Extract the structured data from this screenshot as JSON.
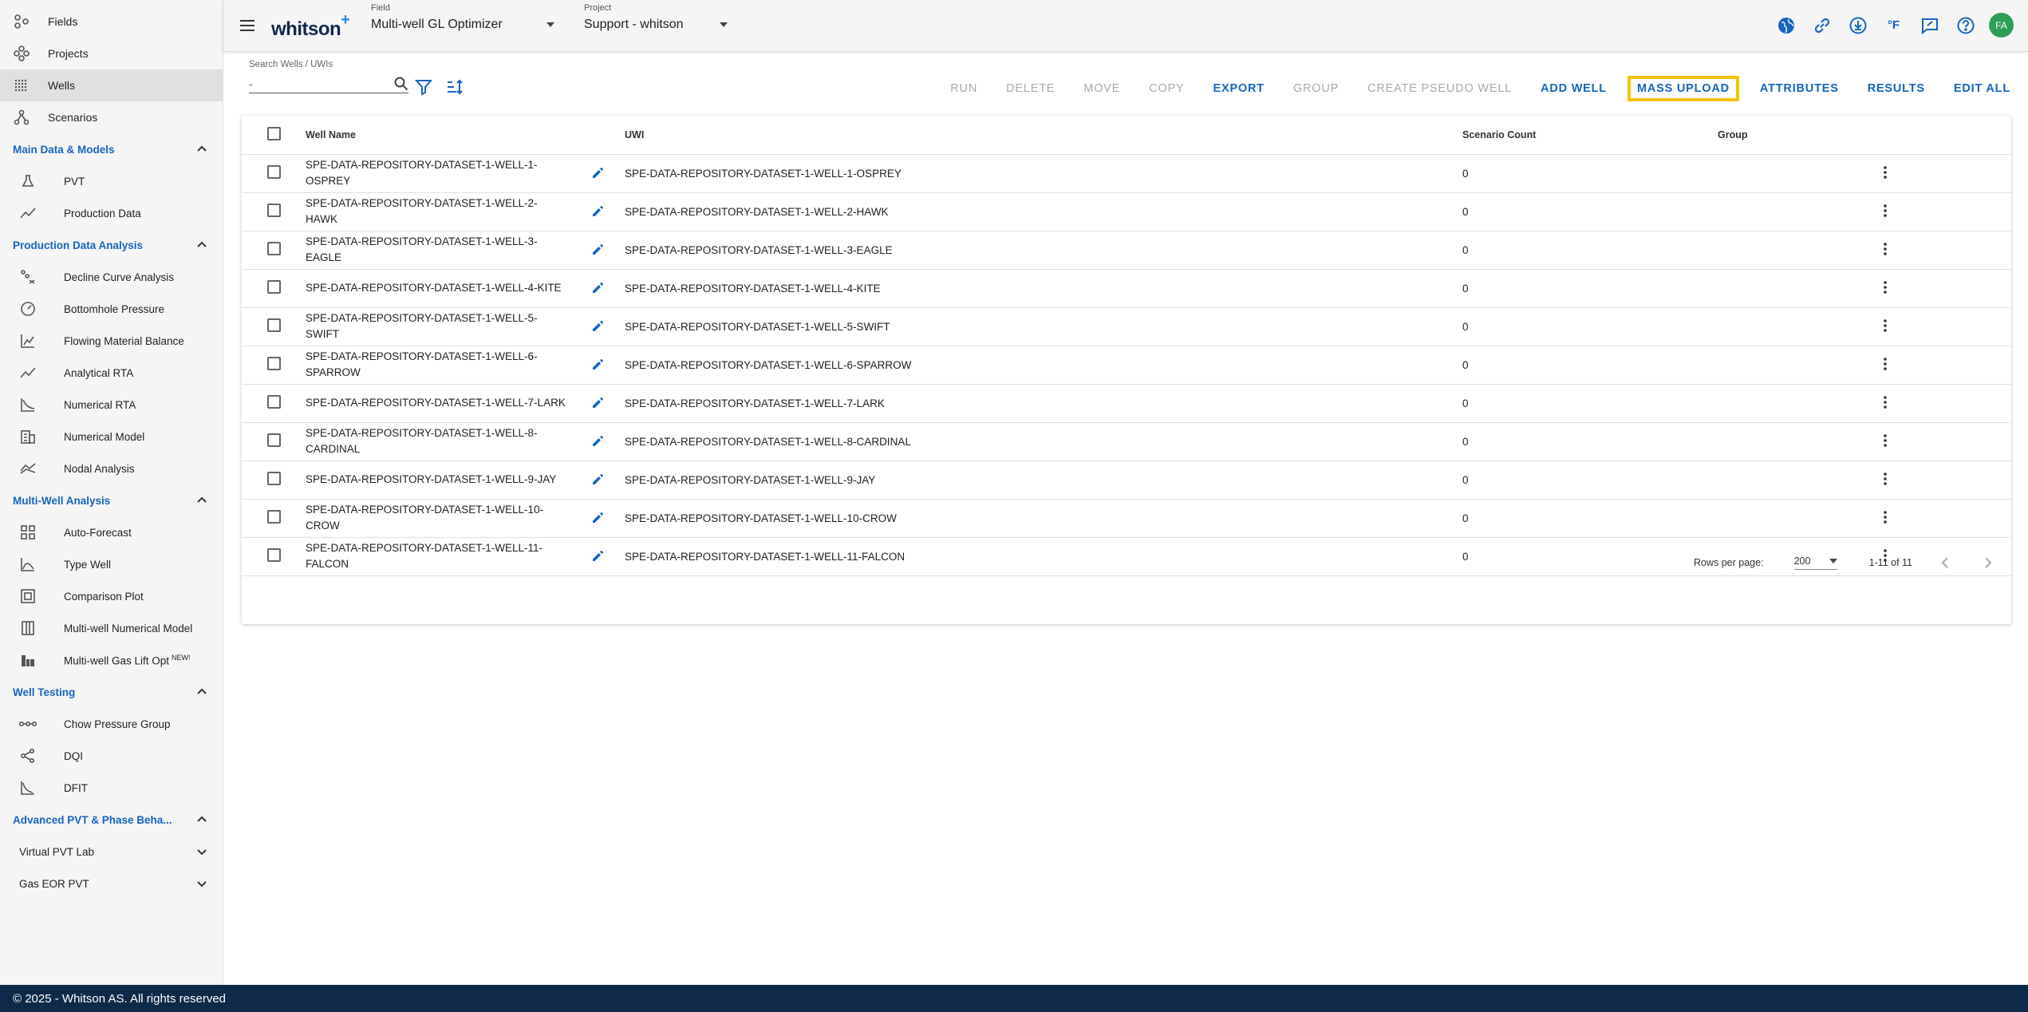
{
  "sidebar": {
    "top_items": [
      {
        "label": "Fields",
        "icon": "fields-icon"
      },
      {
        "label": "Projects",
        "icon": "projects-icon"
      },
      {
        "label": "Wells",
        "icon": "wells-icon",
        "active": true
      },
      {
        "label": "Scenarios",
        "icon": "scenarios-icon"
      }
    ],
    "sections": {
      "main_data": {
        "title": "Main Data & Models",
        "items": [
          "PVT",
          "Production Data"
        ]
      },
      "pda": {
        "title": "Production Data Analysis",
        "items": [
          "Decline Curve Analysis",
          "Bottomhole Pressure",
          "Flowing Material Balance",
          "Analytical RTA",
          "Numerical RTA",
          "Numerical Model",
          "Nodal Analysis"
        ]
      },
      "mwa": {
        "title": "Multi-Well Analysis",
        "items": [
          "Auto-Forecast",
          "Type Well",
          "Comparison Plot",
          "Multi-well Numerical Model",
          "Multi-well Gas Lift Opt"
        ],
        "new_badge": "NEW!"
      },
      "wt": {
        "title": "Well Testing",
        "items": [
          "Chow Pressure Group",
          "DQI",
          "DFIT"
        ]
      },
      "adv": {
        "title": "Advanced PVT & Phase Beha...",
        "items": [
          "Virtual PVT Lab",
          "Gas EOR PVT"
        ]
      }
    }
  },
  "header": {
    "logo": "whitson",
    "logo_plus": "+",
    "field_label": "Field",
    "field_value": "Multi-well GL Optimizer",
    "project_label": "Project",
    "project_value": "Support - whitson",
    "temp_unit": "°F",
    "avatar_initials": "FA"
  },
  "toolbar": {
    "search_label": "Search Wells / UWIs",
    "search_value": "-",
    "actions": {
      "run": "RUN",
      "delete": "DELETE",
      "move": "MOVE",
      "copy": "COPY",
      "export": "EXPORT",
      "group": "GROUP",
      "pseudo": "CREATE PSEUDO WELL",
      "add": "ADD WELL",
      "mass_upload": "MASS UPLOAD",
      "attributes": "ATTRIBUTES",
      "results": "RESULTS",
      "edit_all": "EDIT ALL"
    }
  },
  "table": {
    "headers": {
      "name": "Well Name",
      "uwi": "UWI",
      "count": "Scenario Count",
      "group": "Group"
    },
    "rows": [
      {
        "name": "SPE-DATA-REPOSITORY-DATASET-1-WELL-1-OSPREY",
        "uwi": "SPE-DATA-REPOSITORY-DATASET-1-WELL-1-OSPREY",
        "count": "0",
        "group": ""
      },
      {
        "name": "SPE-DATA-REPOSITORY-DATASET-1-WELL-2-HAWK",
        "uwi": "SPE-DATA-REPOSITORY-DATASET-1-WELL-2-HAWK",
        "count": "0",
        "group": ""
      },
      {
        "name": "SPE-DATA-REPOSITORY-DATASET-1-WELL-3-EAGLE",
        "uwi": "SPE-DATA-REPOSITORY-DATASET-1-WELL-3-EAGLE",
        "count": "0",
        "group": ""
      },
      {
        "name": "SPE-DATA-REPOSITORY-DATASET-1-WELL-4-KITE",
        "uwi": "SPE-DATA-REPOSITORY-DATASET-1-WELL-4-KITE",
        "count": "0",
        "group": ""
      },
      {
        "name": "SPE-DATA-REPOSITORY-DATASET-1-WELL-5-SWIFT",
        "uwi": "SPE-DATA-REPOSITORY-DATASET-1-WELL-5-SWIFT",
        "count": "0",
        "group": ""
      },
      {
        "name": "SPE-DATA-REPOSITORY-DATASET-1-WELL-6-SPARROW",
        "uwi": "SPE-DATA-REPOSITORY-DATASET-1-WELL-6-SPARROW",
        "count": "0",
        "group": ""
      },
      {
        "name": "SPE-DATA-REPOSITORY-DATASET-1-WELL-7-LARK",
        "uwi": "SPE-DATA-REPOSITORY-DATASET-1-WELL-7-LARK",
        "count": "0",
        "group": ""
      },
      {
        "name": "SPE-DATA-REPOSITORY-DATASET-1-WELL-8-CARDINAL",
        "uwi": "SPE-DATA-REPOSITORY-DATASET-1-WELL-8-CARDINAL",
        "count": "0",
        "group": ""
      },
      {
        "name": "SPE-DATA-REPOSITORY-DATASET-1-WELL-9-JAY",
        "uwi": "SPE-DATA-REPOSITORY-DATASET-1-WELL-9-JAY",
        "count": "0",
        "group": ""
      },
      {
        "name": "SPE-DATA-REPOSITORY-DATASET-1-WELL-10-CROW",
        "uwi": "SPE-DATA-REPOSITORY-DATASET-1-WELL-10-CROW",
        "count": "0",
        "group": ""
      },
      {
        "name": "SPE-DATA-REPOSITORY-DATASET-1-WELL-11-FALCON",
        "uwi": "SPE-DATA-REPOSITORY-DATASET-1-WELL-11-FALCON",
        "count": "0",
        "group": ""
      }
    ]
  },
  "pager": {
    "rows_label": "Rows per page:",
    "rows_value": "200",
    "range": "1-11 of 11"
  },
  "colors": {
    "accent": "#1565c0",
    "highlight": "#f5c400",
    "footer": "#0d2a4a",
    "avatar": "#2e9e57"
  },
  "footer": {
    "text": "© 2025 - Whitson AS. All rights reserved"
  }
}
